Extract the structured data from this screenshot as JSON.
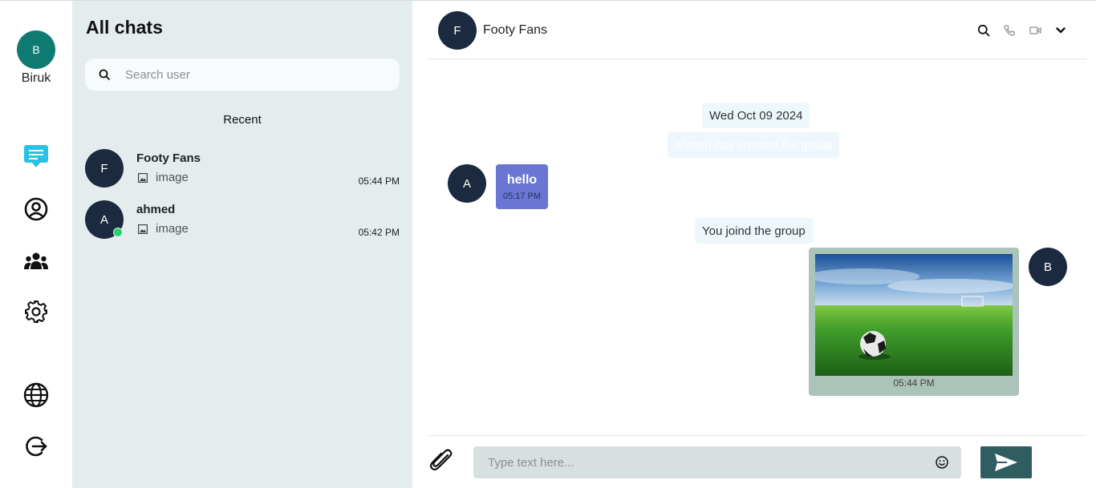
{
  "user": {
    "initial": "B",
    "name": "Biruk"
  },
  "rail": {
    "icons": [
      "chat-icon",
      "profile-icon",
      "groups-icon",
      "settings-icon",
      "language-icon",
      "logout-icon"
    ],
    "active_color": "#29c1e6"
  },
  "list": {
    "title": "All chats",
    "search_placeholder": "Search user",
    "section": "Recent",
    "chats": [
      {
        "initial": "F",
        "name": "Footy Fans",
        "preview": "image",
        "time": "05:44 PM",
        "online": false
      },
      {
        "initial": "A",
        "name": "ahmed",
        "preview": "image",
        "time": "05:42 PM",
        "online": true
      }
    ]
  },
  "conversation": {
    "header": {
      "initial": "F",
      "name": "Footy Fans"
    },
    "date_separator": "Wed Oct 09 2024",
    "system_created": "ahmed has created the group",
    "incoming": {
      "initial": "A",
      "text": "hello",
      "time": "05:17 PM"
    },
    "system_joined": "You joind the group",
    "outgoing_image": {
      "initial": "B",
      "time": "05:44 PM"
    },
    "composer_placeholder": "Type text here..."
  },
  "colors": {
    "avatar_dark": "#1c2a3f",
    "avatar_user": "#0e7a72",
    "incoming_bubble": "#6976d3",
    "image_bubble": "#abc3b8",
    "send_button": "#2f5d62",
    "panel_bg": "#e4ecee"
  }
}
